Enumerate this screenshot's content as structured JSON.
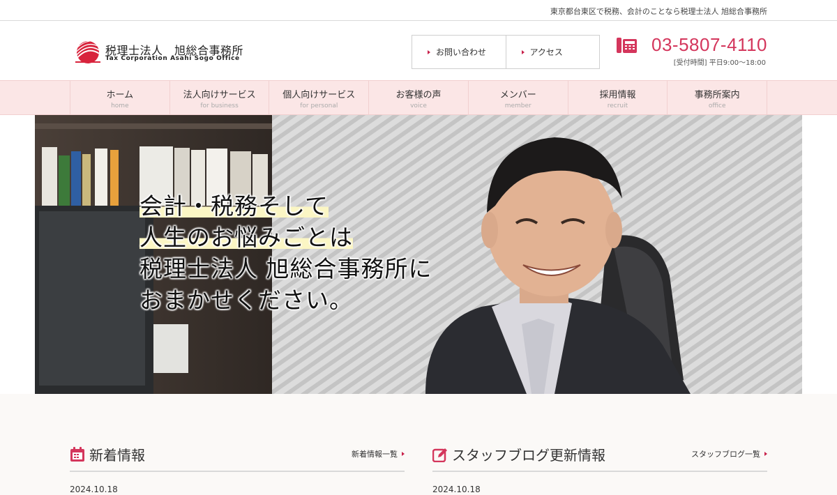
{
  "topbar": {
    "tagline": "東京都台東区で税務、会計のことなら税理士法人 旭総合事務所"
  },
  "logo": {
    "name_jp": "税理士法人　旭総合事務所",
    "name_en": "Tax Corporation Asahi Sogo Office",
    "mark_icon": "rising-sun-logo-icon"
  },
  "header": {
    "links": [
      {
        "label": "お問い合わせ",
        "icon": "triangle-right-icon"
      },
      {
        "label": "アクセス",
        "icon": "triangle-right-icon"
      }
    ],
    "phone": {
      "icon": "telephone-icon",
      "number": "03-5807-4110",
      "hours": "[受付時間] 平日9:00～18:00"
    }
  },
  "nav": [
    {
      "jp": "ホーム",
      "en": "home"
    },
    {
      "jp": "法人向けサービス",
      "en": "for business"
    },
    {
      "jp": "個人向けサービス",
      "en": "for personal"
    },
    {
      "jp": "お客様の声",
      "en": "voice"
    },
    {
      "jp": "メンバー",
      "en": "member"
    },
    {
      "jp": "採用情報",
      "en": "recruit"
    },
    {
      "jp": "事務所案内",
      "en": "office"
    }
  ],
  "hero": {
    "lines": [
      "会計・税務そして",
      "人生のお悩みごとは",
      "税理士法人 旭総合事務所に",
      "おまかせください。"
    ],
    "highlight_lines": [
      0,
      1
    ],
    "highlight_color": "#fbf6c4"
  },
  "news": {
    "title": "新着情報",
    "icon": "calendar-icon",
    "more": "新着情報一覧",
    "items": [
      {
        "date": "2024.10.18"
      }
    ]
  },
  "blog": {
    "title": "スタッフブログ更新情報",
    "icon": "edit-icon",
    "more": "スタッフブログ一覧",
    "items": [
      {
        "date": "2024.10.18"
      }
    ]
  },
  "colors": {
    "accent": "#d4365c",
    "nav_bg": "#fbe6e6",
    "lower_bg": "#fbf9f7"
  }
}
